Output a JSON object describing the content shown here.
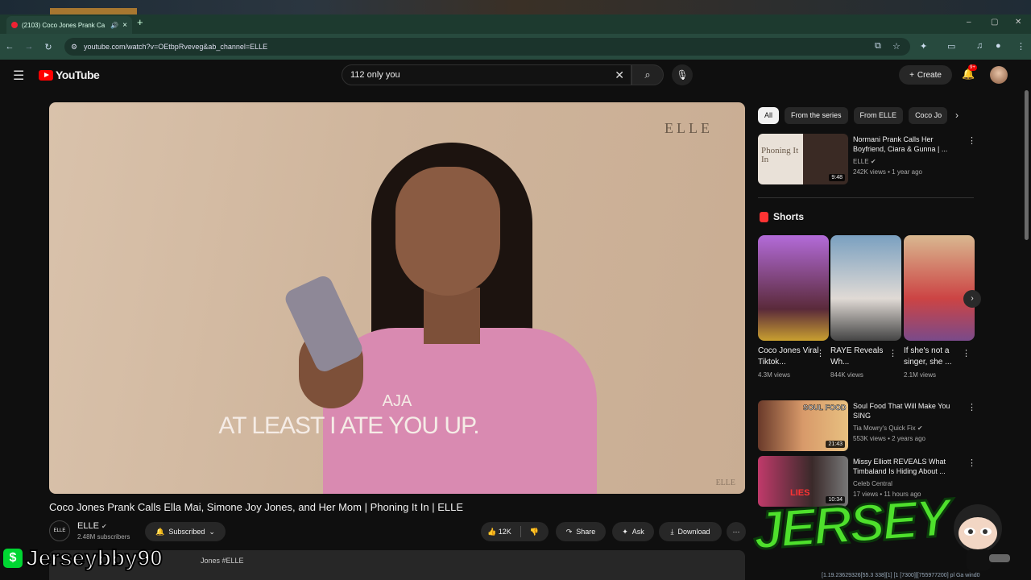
{
  "browser": {
    "tab_title": "(2103) Coco Jones Prank Ca",
    "new_tab": "+",
    "url": "youtube.com/watch?v=OEtbpRveveg&ab_channel=ELLE",
    "win_min": "–",
    "win_max": "▢",
    "win_close": "✕"
  },
  "header": {
    "logo_text": "YouTube",
    "search_value": "112 only you",
    "create_label": "Create",
    "notif_count": "9+"
  },
  "player": {
    "watermark": "ELLE",
    "caption_speaker": "AJA",
    "caption_line": "AT LEAST I ATE YOU UP.",
    "corner_mark": "ELLE"
  },
  "video": {
    "title": "Coco Jones Prank Calls Ella Mai, Simone Joy Jones, and Her Mom | Phoning It In | ELLE",
    "channel_avatar": "ELLE",
    "channel_name": "ELLE",
    "subscribers": "2.48M subscribers",
    "subscribed_label": "Subscribed",
    "likes": "12K",
    "share_label": "Share",
    "ask_label": "Ask",
    "download_label": "Download",
    "description_snippet": "Jones #ELLE"
  },
  "sidebar": {
    "chips": [
      "All",
      "From the series",
      "From ELLE",
      "Coco Jo"
    ],
    "recs": [
      {
        "title": "Normani Prank Calls Her Boyfriend, Ciara & Gunna | ...",
        "channel": "ELLE",
        "meta": "242K views • 1 year ago",
        "duration": "9:48",
        "thumb_text": "Phoning It In"
      },
      {
        "title": "Soul Food That Will Make You SING",
        "channel": "Tia Mowry's Quick Fix",
        "meta": "553K views • 2 years ago",
        "duration": "21:43",
        "thumb_text": "SOUL FOOD"
      },
      {
        "title": "Missy Elliott REVEALS What Timbaland Is Hiding About ...",
        "channel": "Celeb Central",
        "meta": "17 views • 11 hours ago",
        "duration": "10:34",
        "thumb_text": "LIES"
      }
    ],
    "shorts_heading": "Shorts",
    "shorts": [
      {
        "title": "Coco Jones Viral Tiktok...",
        "views": "4.3M views"
      },
      {
        "title": "RAYE Reveals Wh...",
        "views": "844K views"
      },
      {
        "title": "If she's not a singer, she ...",
        "views": "2.1M views"
      }
    ]
  },
  "overlay": {
    "cash_symbol": "$",
    "streamer_name": "Jerseybby90",
    "jersey_logo": "JERSEY",
    "status_text": "[1.19.23629326[55.3 338][1] [1 [7300][[755977200] pl Ga wind0"
  }
}
